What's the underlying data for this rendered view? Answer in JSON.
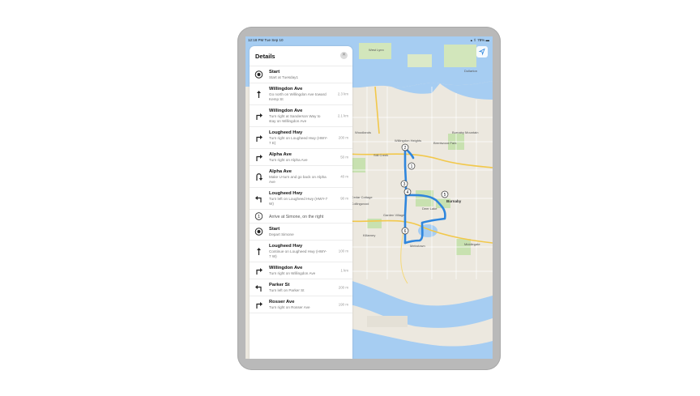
{
  "status": {
    "time": "12:18 PM  Tue Sep 10",
    "right": "▴ ⇪ 78% ▬"
  },
  "panel": {
    "title": "Details"
  },
  "steps": [
    {
      "title": "Start",
      "desc": "Start at Tuesday1",
      "dist": "",
      "icon": "start-icon"
    },
    {
      "title": "Willingdon Ave",
      "desc": "Go north on Willingdon Ave toward Kemp St",
      "dist": "2.3 km",
      "icon": "arrow-up-icon"
    },
    {
      "title": "Willingdon Ave",
      "desc": "Turn right at Sanderson Way to stay on Willingdon Ave",
      "dist": "2.1 km",
      "icon": "turn-right-icon"
    },
    {
      "title": "Lougheed Hwy",
      "desc": "Turn right on Lougheed Hwy (HWY-7 E)",
      "dist": "200 m",
      "icon": "turn-right-icon"
    },
    {
      "title": "Alpha Ave",
      "desc": "Turn right on Alpha Ave",
      "dist": "50 m",
      "icon": "turn-right-icon"
    },
    {
      "title": "Alpha Ave",
      "desc": "Make U-turn and go back on Alpha Ave",
      "dist": "40 m",
      "icon": "u-turn-icon"
    },
    {
      "title": "Lougheed Hwy",
      "desc": "Turn left on Lougheed Hwy (HWY-7 W)",
      "dist": "90 m",
      "icon": "turn-left-icon"
    },
    {
      "title": "Arrive at Simone, on the right",
      "desc": "",
      "dist": "",
      "icon": "stop-1-icon",
      "arrive": true
    },
    {
      "title": "Start",
      "desc": "Depart Simone",
      "dist": "",
      "icon": "start-icon"
    },
    {
      "title": "Lougheed Hwy",
      "desc": "Continue on Lougheed Hwy (HWY-7 W)",
      "dist": "100 m",
      "icon": "arrow-up-icon"
    },
    {
      "title": "Willingdon Ave",
      "desc": "Turn right on Willingdon Ave",
      "dist": "1 km",
      "icon": "turn-right-icon"
    },
    {
      "title": "Parker St",
      "desc": "Turn left on Parker St",
      "dist": "200 m",
      "icon": "turn-left-icon"
    },
    {
      "title": "Rosser Ave",
      "desc": "Turn right on Rosser Ave",
      "dist": "190 m",
      "icon": "turn-right-icon"
    }
  ],
  "map": {
    "labels": {
      "west_lynn": "West Lynn",
      "dollarton": "Dollarton",
      "woodlands": "Woodlands",
      "brentwood": "Brentwood Park",
      "willingdon": "Willingdon Heights",
      "still_creek": "Still Creek",
      "burnaby": "Burnaby",
      "cedar": "n-Cedar Cottage",
      "collingwood": "n-Collingwood",
      "garden": "Garden Village",
      "killarney": "Killarney",
      "metrotown": "Metrotown",
      "middlegate": "Middlegate",
      "burnaby_mtn": "Burnaby Mountain",
      "deer_lake": "Deer Lake"
    },
    "markers": [
      "1",
      "2",
      "3",
      "4",
      "5",
      "6"
    ],
    "colors": {
      "route": "#2f86dd",
      "water": "#a6cdf2",
      "park": "#c8e1b0",
      "land": "#ece8e0",
      "highway": "#f2c84b"
    }
  }
}
